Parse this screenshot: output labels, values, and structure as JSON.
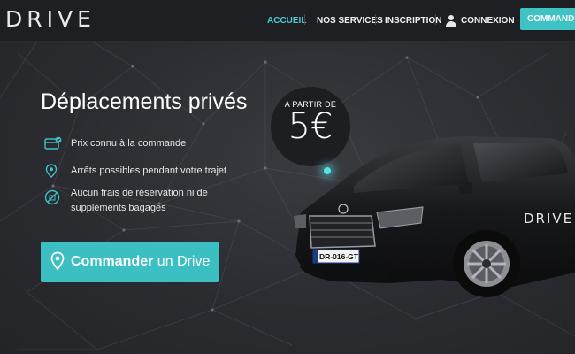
{
  "header": {
    "logo": "DRIVE",
    "nav": [
      "ACCUEIL",
      "NOS SERVICES",
      "INSCRIPTION",
      "CONNEXION"
    ],
    "order_button": "COMMANDER"
  },
  "hero": {
    "title": "Déplacements privés",
    "features": [
      {
        "icon": "card-icon",
        "text": "Prix connu à la commande"
      },
      {
        "icon": "location-pin-icon",
        "text": "Arrêts possibles pendant votre trajet"
      },
      {
        "icon": "no-fee-icon",
        "text_line1": "Aucun frais de réservation ni de",
        "text_line2": "suppléments bagages"
      }
    ],
    "price_badge": {
      "label": "A PARTIR DE",
      "price": "5€"
    },
    "cta": {
      "strong": "Commander",
      "rest": " un Drive"
    },
    "car": {
      "plate": "DR-016-GT",
      "door_logo": "DRIVE"
    }
  },
  "colors": {
    "accent": "#3ec2c4",
    "background": "#2a2b30",
    "header": "#1e1f23"
  }
}
